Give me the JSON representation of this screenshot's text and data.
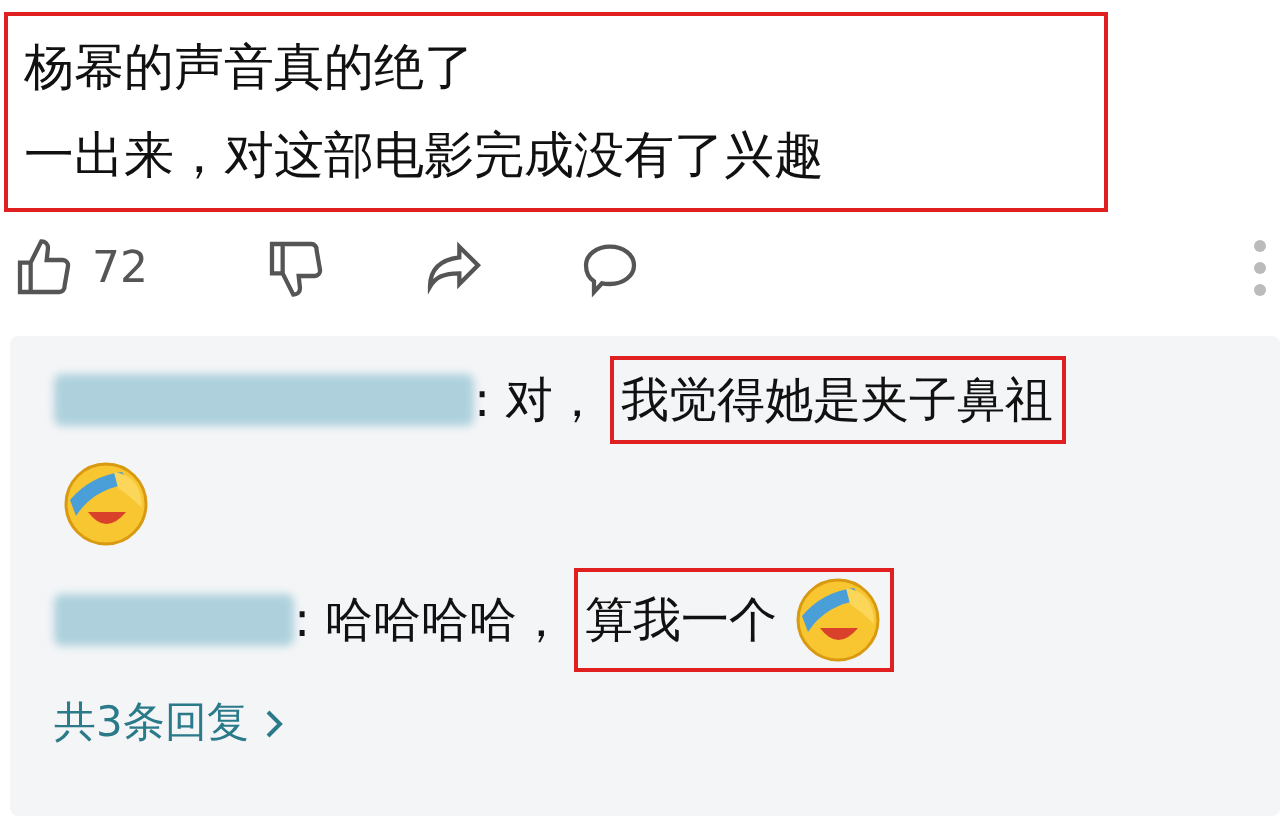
{
  "comment": {
    "lines": [
      "杨幂的声音真的绝了",
      "一出来，对这部电影完成没有了兴趣"
    ],
    "highlighted": true
  },
  "actions": {
    "like_count": "72"
  },
  "replies": [
    {
      "kind": "emoji_below",
      "text": ": 对，",
      "highlight": "我觉得她是夹子鼻祖"
    },
    {
      "kind": "emoji_inline",
      "text": ": 哈哈哈哈，",
      "highlight": "算我一个"
    }
  ],
  "more_replies": "共3条回复"
}
